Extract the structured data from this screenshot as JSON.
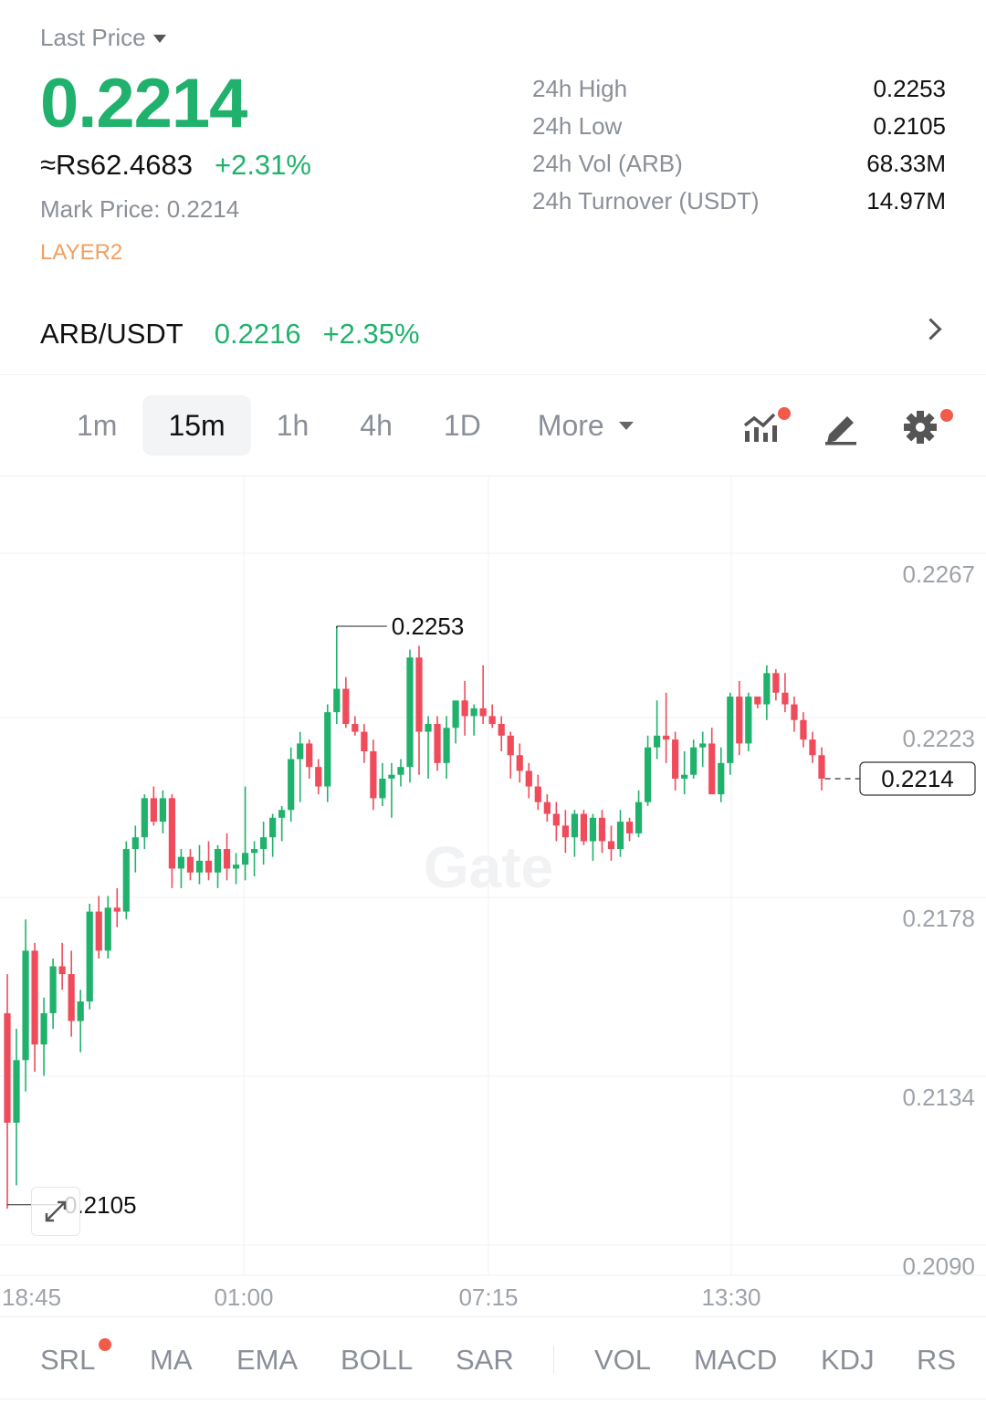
{
  "header": {
    "last_price_label": "Last Price",
    "last_price": "0.2214",
    "fiat_price": "≈Rs62.4683",
    "change_pct": "+2.31%",
    "mark_price_label": "Mark Price:",
    "mark_price": "0.2214",
    "tag": "LAYER2",
    "stats": [
      {
        "label": "24h High",
        "value": "0.2253"
      },
      {
        "label": "24h Low",
        "value": "0.2105"
      },
      {
        "label": "24h Vol (ARB)",
        "value": "68.33M"
      },
      {
        "label": "24h Turnover (USDT)",
        "value": "14.97M"
      }
    ]
  },
  "pair": {
    "symbol": "ARB/USDT",
    "price": "0.2216",
    "change": "+2.35%"
  },
  "intervals": [
    "1m",
    "15m",
    "1h",
    "4h",
    "1D"
  ],
  "active_interval": "15m",
  "more_label": "More",
  "toolbar_icons": [
    "chart-indicator-icon",
    "draw-pencil-icon",
    "settings-gear-icon"
  ],
  "colors": {
    "up": "#20b26c",
    "down": "#ef4b5b",
    "accent_dot": "#f25a4a",
    "tag": "#f0a061"
  },
  "chart_data": {
    "type": "candlestick",
    "y_ticks": [
      "0.2267",
      "0.2223",
      "0.2178",
      "0.2134",
      "0.2090"
    ],
    "x_ticks": [
      "18:45",
      "01:00",
      "07:15",
      "13:30"
    ],
    "ylim": [
      0.209,
      0.2267
    ],
    "high_label": "0.2253",
    "low_label": "0.2105",
    "current_price_label": "0.2214",
    "watermark": "Gate",
    "candles": [
      [
        0.2154,
        0.2164,
        0.2104,
        0.2126
      ],
      [
        0.2126,
        0.215,
        0.211,
        0.2142
      ],
      [
        0.2142,
        0.2178,
        0.2134,
        0.217
      ],
      [
        0.217,
        0.2172,
        0.2139,
        0.2146
      ],
      [
        0.2146,
        0.2158,
        0.2138,
        0.2154
      ],
      [
        0.2154,
        0.2168,
        0.215,
        0.2166
      ],
      [
        0.2166,
        0.2172,
        0.216,
        0.2164
      ],
      [
        0.2164,
        0.217,
        0.2148,
        0.2152
      ],
      [
        0.2152,
        0.216,
        0.2144,
        0.2157
      ],
      [
        0.2157,
        0.2182,
        0.2155,
        0.218
      ],
      [
        0.218,
        0.2184,
        0.2168,
        0.217
      ],
      [
        0.217,
        0.2184,
        0.2168,
        0.2181
      ],
      [
        0.2181,
        0.2186,
        0.2176,
        0.218
      ],
      [
        0.218,
        0.2198,
        0.2178,
        0.2196
      ],
      [
        0.2196,
        0.2202,
        0.219,
        0.2199
      ],
      [
        0.2199,
        0.221,
        0.2196,
        0.2209
      ],
      [
        0.2209,
        0.2212,
        0.2202,
        0.2203
      ],
      [
        0.2203,
        0.2211,
        0.22,
        0.2209
      ],
      [
        0.2209,
        0.221,
        0.2186,
        0.2191
      ],
      [
        0.2191,
        0.2196,
        0.2186,
        0.2194
      ],
      [
        0.2194,
        0.2196,
        0.2188,
        0.219
      ],
      [
        0.219,
        0.2197,
        0.2187,
        0.2193
      ],
      [
        0.2193,
        0.2198,
        0.2188,
        0.219
      ],
      [
        0.219,
        0.2197,
        0.2186,
        0.2196
      ],
      [
        0.2196,
        0.22,
        0.2188,
        0.2191
      ],
      [
        0.2191,
        0.2195,
        0.2187,
        0.2192
      ],
      [
        0.2192,
        0.2212,
        0.2188,
        0.2195
      ],
      [
        0.2195,
        0.2198,
        0.2189,
        0.2196
      ],
      [
        0.2196,
        0.2203,
        0.2192,
        0.2199
      ],
      [
        0.2199,
        0.2205,
        0.2194,
        0.2204
      ],
      [
        0.2204,
        0.2207,
        0.2198,
        0.2206
      ],
      [
        0.2206,
        0.2222,
        0.2203,
        0.2219
      ],
      [
        0.2219,
        0.2226,
        0.2208,
        0.2223
      ],
      [
        0.2223,
        0.2224,
        0.2214,
        0.2217
      ],
      [
        0.2217,
        0.2219,
        0.221,
        0.2212
      ],
      [
        0.2212,
        0.2233,
        0.2208,
        0.2231
      ],
      [
        0.2231,
        0.2253,
        0.2228,
        0.2237
      ],
      [
        0.2237,
        0.224,
        0.2227,
        0.2228
      ],
      [
        0.2228,
        0.223,
        0.2225,
        0.2226
      ],
      [
        0.2226,
        0.2228,
        0.2218,
        0.2221
      ],
      [
        0.2221,
        0.2224,
        0.2206,
        0.2209
      ],
      [
        0.2209,
        0.2218,
        0.2207,
        0.2214
      ],
      [
        0.2214,
        0.2218,
        0.2204,
        0.2215
      ],
      [
        0.2215,
        0.2219,
        0.2212,
        0.2217
      ],
      [
        0.2217,
        0.2247,
        0.2213,
        0.2245
      ],
      [
        0.2245,
        0.2248,
        0.2215,
        0.2226
      ],
      [
        0.2226,
        0.223,
        0.2214,
        0.2228
      ],
      [
        0.2228,
        0.223,
        0.2216,
        0.2218
      ],
      [
        0.2218,
        0.223,
        0.2214,
        0.2227
      ],
      [
        0.2227,
        0.2233,
        0.2223,
        0.2234
      ],
      [
        0.2234,
        0.2239,
        0.2225,
        0.223
      ],
      [
        0.223,
        0.2233,
        0.2225,
        0.2232
      ],
      [
        0.2232,
        0.2243,
        0.2228,
        0.223
      ],
      [
        0.223,
        0.2233,
        0.2227,
        0.2228
      ],
      [
        0.2228,
        0.223,
        0.2221,
        0.2225
      ],
      [
        0.2225,
        0.2226,
        0.2214,
        0.222
      ],
      [
        0.222,
        0.2223,
        0.2213,
        0.2216
      ],
      [
        0.2216,
        0.2218,
        0.2209,
        0.2212
      ],
      [
        0.2212,
        0.2215,
        0.2206,
        0.2208
      ],
      [
        0.2208,
        0.221,
        0.2203,
        0.2205
      ],
      [
        0.2205,
        0.2208,
        0.2198,
        0.2202
      ],
      [
        0.2202,
        0.2206,
        0.2195,
        0.2199
      ],
      [
        0.2199,
        0.2206,
        0.2194,
        0.2205
      ],
      [
        0.2205,
        0.2206,
        0.2197,
        0.2198
      ],
      [
        0.2198,
        0.2205,
        0.2193,
        0.2204
      ],
      [
        0.2204,
        0.2206,
        0.2195,
        0.2198
      ],
      [
        0.2198,
        0.2202,
        0.2193,
        0.2196
      ],
      [
        0.2196,
        0.2206,
        0.2194,
        0.2203
      ],
      [
        0.2203,
        0.2204,
        0.2198,
        0.22
      ],
      [
        0.22,
        0.2211,
        0.2199,
        0.2208
      ],
      [
        0.2208,
        0.2225,
        0.2207,
        0.2222
      ],
      [
        0.2222,
        0.2234,
        0.2219,
        0.2225
      ],
      [
        0.2225,
        0.2236,
        0.2218,
        0.2224
      ],
      [
        0.2224,
        0.2226,
        0.2211,
        0.2214
      ],
      [
        0.2214,
        0.2221,
        0.221,
        0.2215
      ],
      [
        0.2215,
        0.2224,
        0.2214,
        0.2222
      ],
      [
        0.2222,
        0.2226,
        0.2217,
        0.2223
      ],
      [
        0.2223,
        0.2227,
        0.2211,
        0.221
      ],
      [
        0.221,
        0.2222,
        0.2208,
        0.2218
      ],
      [
        0.2218,
        0.2236,
        0.2215,
        0.2235
      ],
      [
        0.2235,
        0.2239,
        0.222,
        0.2223
      ],
      [
        0.2223,
        0.2236,
        0.2221,
        0.2235
      ],
      [
        0.2235,
        0.2235,
        0.2232,
        0.2233
      ],
      [
        0.2233,
        0.2243,
        0.2229,
        0.2241
      ],
      [
        0.2241,
        0.2242,
        0.2234,
        0.2236
      ],
      [
        0.2236,
        0.2241,
        0.2231,
        0.2233
      ],
      [
        0.2233,
        0.2235,
        0.2226,
        0.2229
      ],
      [
        0.2229,
        0.2231,
        0.2222,
        0.2224
      ],
      [
        0.2224,
        0.2226,
        0.2218,
        0.222
      ],
      [
        0.222,
        0.2222,
        0.2211,
        0.2214
      ]
    ]
  },
  "indicators": {
    "main": [
      "SRL",
      "MA",
      "EMA",
      "BOLL",
      "SAR"
    ],
    "sub": [
      "VOL",
      "MACD",
      "KDJ",
      "RSI"
    ]
  }
}
